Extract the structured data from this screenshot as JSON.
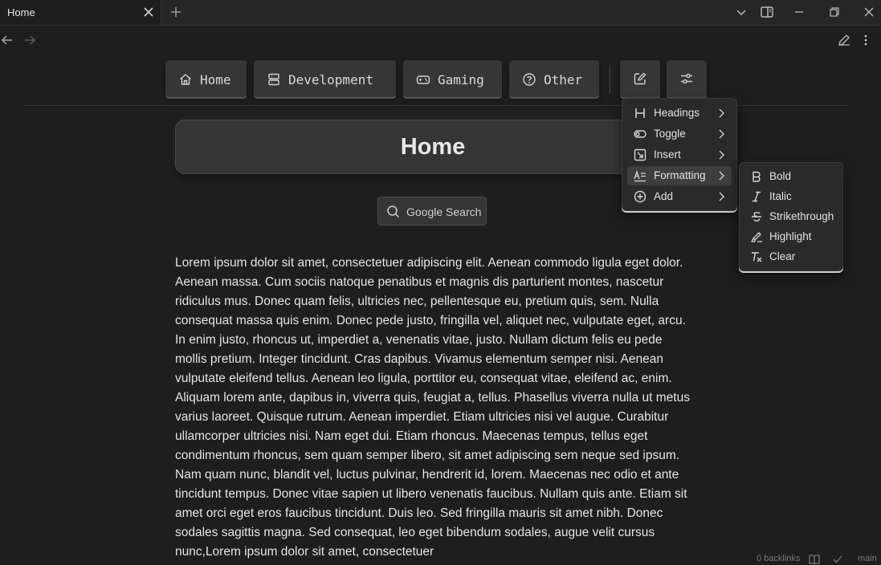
{
  "tab": {
    "title": "Home",
    "close_icon": "close-icon",
    "new_tab_icon": "plus-icon"
  },
  "window_controls": [
    "chevron-down-icon",
    "sidebar-toggle-icon",
    "minimize-icon",
    "restore-icon",
    "close-icon"
  ],
  "nav": {
    "back_icon": "arrow-left-icon",
    "forward_icon": "arrow-right-icon",
    "edit_icon": "pencil-icon",
    "more_icon": "more-vertical-icon"
  },
  "links": [
    {
      "label": "Home",
      "icon": "house-icon"
    },
    {
      "label": "Development",
      "icon": "server-icon"
    },
    {
      "label": "Gaming",
      "icon": "gamepad-icon"
    },
    {
      "label": "Other",
      "icon": "help-circle-icon"
    }
  ],
  "tool_buttons": [
    {
      "icon": "edit-square-icon"
    },
    {
      "icon": "settings-sliders-icon"
    }
  ],
  "note": {
    "title": "Home",
    "search_label": "Google Search",
    "body": "Lorem ipsum dolor sit amet, consectetuer adipiscing elit. Aenean commodo ligula eget dolor. Aenean massa. Cum sociis natoque penatibus et magnis dis parturient montes, nascetur ridiculus mus. Donec quam felis, ultricies nec, pellentesque eu, pretium quis, sem. Nulla consequat massa quis enim. Donec pede justo, fringilla vel, aliquet nec, vulputate eget, arcu. In enim justo, rhoncus ut, imperdiet a, venenatis vitae, justo. Nullam dictum felis eu pede mollis pretium. Integer tincidunt. Cras dapibus. Vivamus elementum semper nisi. Aenean vulputate eleifend tellus. Aenean leo ligula, porttitor eu, consequat vitae, eleifend ac, enim. Aliquam lorem ante, dapibus in, viverra quis, feugiat a, tellus. Phasellus viverra nulla ut metus varius laoreet. Quisque rutrum. Aenean imperdiet. Etiam ultricies nisi vel augue. Curabitur ullamcorper ultricies nisi. Nam eget dui. Etiam rhoncus. Maecenas tempus, tellus eget condimentum rhoncus, sem quam semper libero, sit amet adipiscing sem neque sed ipsum. Nam quam nunc, blandit vel, luctus pulvinar, hendrerit id, lorem. Maecenas nec odio et ante tincidunt tempus. Donec vitae sapien ut libero venenatis faucibus. Nullam quis ante. Etiam sit amet orci eget eros faucibus tincidunt. Duis leo. Sed fringilla mauris sit amet nibh. Donec sodales sagittis magna. Sed consequat, leo eget bibendum sodales, augue velit cursus nunc,Lorem ipsum dolor sit amet, consectetuer"
  },
  "menu": {
    "items": [
      {
        "label": "Headings",
        "icon": "heading-icon"
      },
      {
        "label": "Toggle",
        "icon": "toggle-icon"
      },
      {
        "label": "Insert",
        "icon": "insert-icon"
      },
      {
        "label": "Formatting",
        "icon": "formatting-icon",
        "active": true
      },
      {
        "label": "Add",
        "icon": "plus-circle-icon"
      }
    ]
  },
  "submenu": {
    "items": [
      {
        "label": "Bold",
        "icon": "bold-icon"
      },
      {
        "label": "Italic",
        "icon": "italic-icon"
      },
      {
        "label": "Strikethrough",
        "icon": "strikethrough-icon"
      },
      {
        "label": "Highlight",
        "icon": "highlighter-icon"
      },
      {
        "label": "Clear",
        "icon": "clear-formatting-icon"
      }
    ]
  },
  "status": {
    "backlinks": "0 backlinks",
    "branch": "main",
    "reading_icon": "book-open-icon",
    "check_icon": "check-icon"
  },
  "colors": {
    "background": "#1e1e1e",
    "panel": "#363636",
    "menu": "#2a2a2a",
    "accent_underline": "#d8c8cc"
  }
}
